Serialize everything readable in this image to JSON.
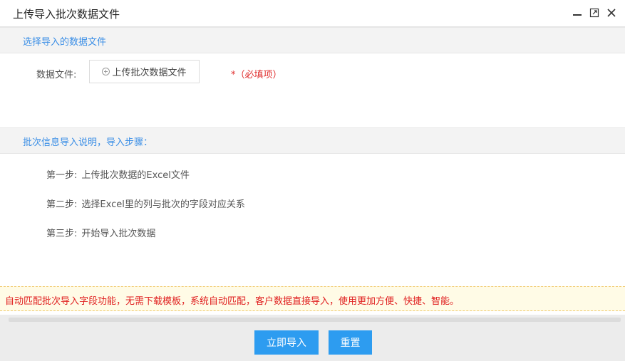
{
  "window": {
    "title": "上传导入批次数据文件",
    "controls": [
      "minimize-icon",
      "maximize-icon",
      "close-icon"
    ]
  },
  "upload_section": {
    "header": "选择导入的数据文件",
    "field_label": "数据文件:",
    "upload_button": "上传批次数据文件",
    "required_note": "*（必填项）"
  },
  "instructions": {
    "header": "批次信息导入说明，导入步骤：",
    "steps": [
      {
        "label": "第一步:",
        "text": "上传批次数据的Excel文件"
      },
      {
        "label": "第二步:",
        "text": "选择Excel里的列与批次的字段对应关系"
      },
      {
        "label": "第三步:",
        "text": "开始导入批次数据"
      }
    ]
  },
  "notice": "自动匹配批次导入字段功能，无需下载模板，系统自动匹配，客户数据直接导入，使用更加方便、快捷、智能。",
  "footer": {
    "import_button": "立即导入",
    "reset_button": "重置"
  },
  "colors": {
    "accent": "#2d9cf0",
    "section_title": "#3a8ee6",
    "required": "#e03030",
    "notice_text": "#e02020",
    "notice_bg": "#fffbe6"
  }
}
